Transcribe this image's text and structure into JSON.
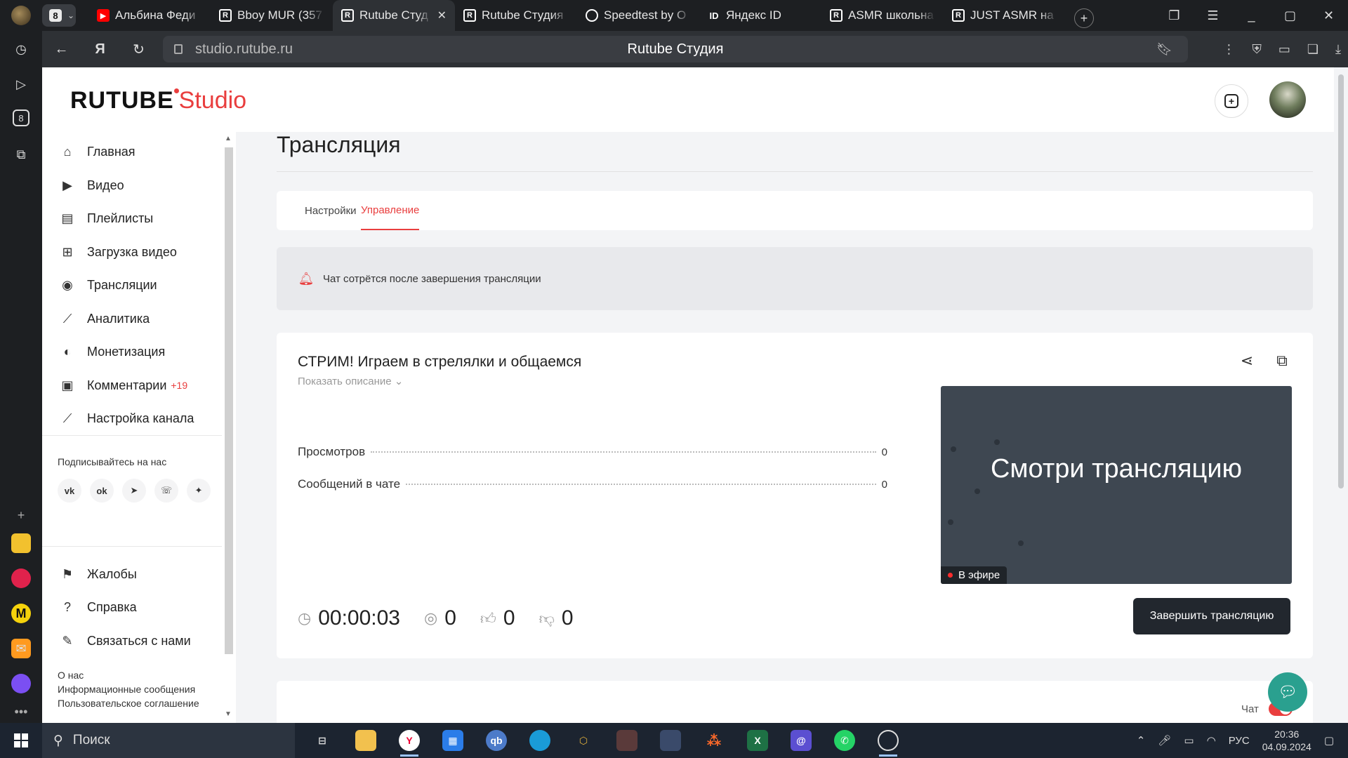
{
  "browser": {
    "tab_count": "8",
    "tabs": [
      {
        "label": "Альбина Феди",
        "favicon": "youtube-icon"
      },
      {
        "label": "Bboy MUR (357",
        "favicon": "rutube-icon"
      },
      {
        "label": "Rutube Студ",
        "favicon": "rutube-icon",
        "active": true
      },
      {
        "label": "Rutube Студия",
        "favicon": "rutube-icon"
      },
      {
        "label": "Speedtest by O",
        "favicon": "speedtest-icon"
      },
      {
        "label": "Яндекс ID",
        "favicon": "yandex-id-icon"
      },
      {
        "label": "ASMR школьна",
        "favicon": "rutube-icon"
      },
      {
        "label": "JUST ASMR на",
        "favicon": "rutube-icon"
      }
    ],
    "id_favicon_text": "ID",
    "r_favicon_text": "R",
    "url": "studio.rutube.ru",
    "page_title": "Rutube Студия",
    "left_badge": "8"
  },
  "header": {
    "logo_main": "RUTUBE",
    "logo_studio": "Studio"
  },
  "sidebar": {
    "items": [
      {
        "label": "Главная",
        "icon": "home-icon"
      },
      {
        "label": "Видео",
        "icon": "video-icon"
      },
      {
        "label": "Плейлисты",
        "icon": "playlist-icon"
      },
      {
        "label": "Загрузка видео",
        "icon": "upload-icon"
      },
      {
        "label": "Трансляции",
        "icon": "broadcast-icon"
      },
      {
        "label": "Аналитика",
        "icon": "analytics-icon"
      },
      {
        "label": "Монетизация",
        "icon": "monetization-icon"
      },
      {
        "label": "Комментарии",
        "icon": "comments-icon",
        "badge": "+19"
      },
      {
        "label": "Настройка канала",
        "icon": "wand-icon"
      }
    ],
    "follow_label": "Подписывайтесь на нас",
    "socials": [
      "vk-icon",
      "ok-icon",
      "telegram-icon",
      "viber-icon",
      "dzen-icon"
    ],
    "bottom_items": [
      {
        "label": "Жалобы",
        "icon": "flag-icon"
      },
      {
        "label": "Справка",
        "icon": "help-icon"
      },
      {
        "label": "Связаться с нами",
        "icon": "edit-icon"
      }
    ],
    "footer_links": [
      "О нас",
      "Информационные сообщения",
      "Пользовательское соглашение"
    ]
  },
  "main": {
    "title": "Трансляция",
    "tabs": [
      {
        "label": "Настройки"
      },
      {
        "label": "Управление",
        "active": true
      }
    ],
    "notice": "Чат сотрётся после завершения трансляции",
    "stream": {
      "title": "СТРИМ! Играем в стрелялки и общаемся",
      "show_description": "Показать описание",
      "stats": [
        {
          "label": "Просмотров",
          "value": "0"
        },
        {
          "label": "Сообщений в чате",
          "value": "0"
        }
      ],
      "preview_text": "Смотри трансляцию",
      "live_badge": "В эфире",
      "timer": "00:00:03",
      "viewers": "0",
      "likes": "0",
      "dislikes": "0",
      "end_button": "Завершить трансляцию"
    },
    "chat_label": "Чат"
  },
  "taskbar": {
    "search_placeholder": "Поиск",
    "lang": "РУС",
    "time": "20:36",
    "date": "04.09.2024"
  },
  "colors": {
    "accent": "#e93e3e",
    "dark_button": "#22272e",
    "fab": "#2aa08f"
  }
}
